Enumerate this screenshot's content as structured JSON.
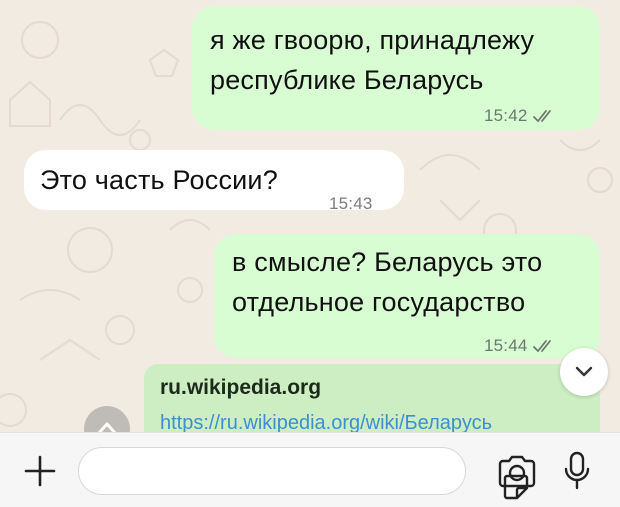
{
  "messages": [
    {
      "direction": "out",
      "text": "я же гвоорю, принадлежу\nреспублике Беларусь",
      "time": "15:42"
    },
    {
      "direction": "in",
      "text": "Это часть России?",
      "time": "15:43"
    },
    {
      "direction": "out",
      "text": "в смысле? Беларусь это\nотдельное государство",
      "time": "15:44"
    }
  ],
  "link_preview": {
    "domain": "ru.wikipedia.org",
    "url": "https://ru.wikipedia.org/wiki/Беларусь"
  },
  "composer": {
    "placeholder": "",
    "value": ""
  },
  "icons": {
    "attach": "plus-icon",
    "sticker": "sticker-icon",
    "camera": "camera-icon",
    "mic": "microphone-icon",
    "scroll": "chevron-down-icon",
    "ticks": "double-check-icon",
    "forward": "forward-icon"
  },
  "colors": {
    "outgoing_bubble": "#d9fdd3",
    "incoming_bubble": "#ffffff",
    "link": "#3d8fd1",
    "read_ticks": "#6b7a6e"
  }
}
